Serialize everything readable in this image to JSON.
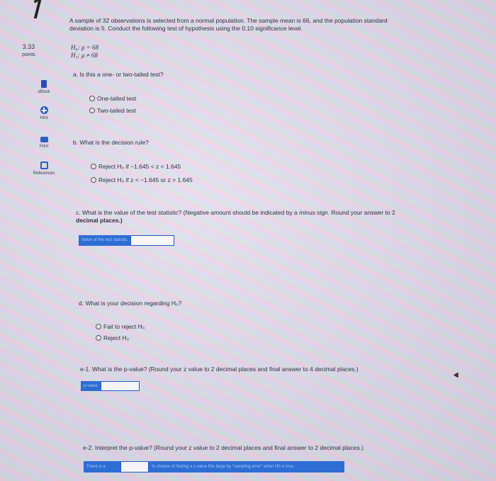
{
  "points": {
    "value": "3.33",
    "label": "points"
  },
  "sidebar": [
    {
      "label": "eBook",
      "icon": "book-icon"
    },
    {
      "label": "Hint",
      "icon": "hint-icon"
    },
    {
      "label": "Print",
      "icon": "print-icon"
    },
    {
      "label": "References",
      "icon": "references-icon"
    }
  ],
  "question": {
    "line1": "A sample of 32 observations is selected from a normal population. The sample mean is 66, and the population standard",
    "line2": "deviation is 5. Conduct the following test of hypothesis using the 0.10 significance level.",
    "h0": "H₀: μ = 68",
    "h1": "H₁: μ ≠ 68"
  },
  "part_a": {
    "prompt": "a. Is this a one- or two-tailed test?",
    "options": [
      "One-tailed test",
      "Two-tailed test"
    ]
  },
  "part_b": {
    "prompt": "b. What is the decision rule?",
    "options": [
      "Reject H₀ if −1.645 < z < 1.645",
      "Reject H₀ if z < −1.645 or z > 1.645"
    ]
  },
  "part_c": {
    "prompt_line1": "c. What is the value of the test statistic? (Negative amount should be indicated by a minus sign. Round your answer to 2",
    "prompt_line2": "decimal places.)",
    "input_label": "Value of the test statistic",
    "input_value": ""
  },
  "part_d": {
    "prompt": "d. What is your decision regarding H₀?",
    "options": [
      "Fail to reject H₀",
      "Reject H₀"
    ]
  },
  "part_e1": {
    "prompt": "e-1. What is the p-value? (Round your z value to 2 decimal places and final answer to 4 decimal places.)",
    "input_label": "p-value",
    "input_value": ""
  },
  "part_e2": {
    "prompt": "e-2. Interpret the p-value? (Round your z value to 2 decimal places and final answer to 2 decimal places.)",
    "prefix_label": "There is a",
    "input_value": "",
    "suffix_label": "% chance of finding a z value this large by \"sampling error\" when H0 is true."
  }
}
